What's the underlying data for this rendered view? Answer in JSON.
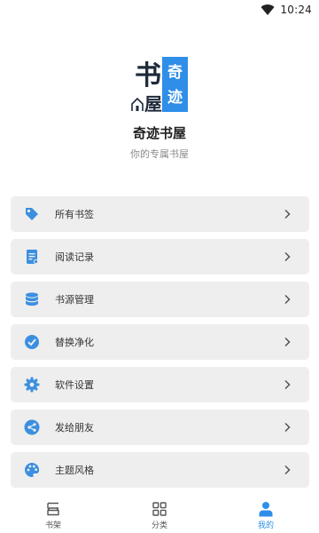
{
  "status_bar": {
    "time": "10:24",
    "wifi_icon": "wifi-icon"
  },
  "app": {
    "logo_icon": "book-house-logo",
    "logo_chars": [
      "书",
      "屋",
      "奇",
      "迹"
    ],
    "title": "奇迹书屋",
    "subtitle": "你的专属书屋"
  },
  "accent_color": "#2f8ee8",
  "menu": [
    {
      "label": "所有书签",
      "icon": "tag-icon"
    },
    {
      "label": "阅读记录",
      "icon": "document-icon"
    },
    {
      "label": "书源管理",
      "icon": "database-icon"
    },
    {
      "label": "替换净化",
      "icon": "check-circle-icon"
    },
    {
      "label": "软件设置",
      "icon": "gear-icon"
    },
    {
      "label": "发给朋友",
      "icon": "share-icon"
    },
    {
      "label": "主题风格",
      "icon": "palette-icon"
    }
  ],
  "tabs": [
    {
      "label": "书架",
      "icon": "bookshelf-icon",
      "active": false
    },
    {
      "label": "分类",
      "icon": "grid-icon",
      "active": false
    },
    {
      "label": "我的",
      "icon": "person-icon",
      "active": true
    }
  ]
}
